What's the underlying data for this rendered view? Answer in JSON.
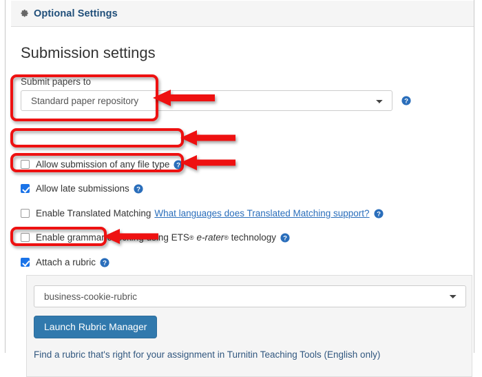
{
  "header": {
    "gear_icon": "gear-icon",
    "title": "Optional Settings"
  },
  "main": {
    "heading": "Submission settings",
    "submit_papers_to": {
      "label": "Submit papers to",
      "selected": "Standard paper repository",
      "help_icon": "question-mark-circle-icon"
    },
    "checkboxes": [
      {
        "name": "allow-any-file-type",
        "label": "Allow submission of any file type",
        "checked": false,
        "help_icon": "question-mark-circle-icon"
      },
      {
        "name": "allow-late-submissions",
        "label": "Allow late submissions",
        "checked": true,
        "help_icon": "question-mark-circle-icon"
      },
      {
        "name": "enable-translated-matching",
        "label": "Enable Translated Matching",
        "link": "What languages does Translated Matching support?",
        "checked": false,
        "help_icon": "question-mark-circle-icon"
      },
      {
        "name": "enable-grammar-check",
        "label_part1": "Enable grammar checking using ETS",
        "reg1": "®",
        "label_italic": "e-rater",
        "reg2": "®",
        "label_part2": "technology",
        "checked": false,
        "help_icon": "question-mark-circle-icon"
      },
      {
        "name": "attach-a-rubric",
        "label": "Attach a rubric",
        "checked": true,
        "help_icon": "question-mark-circle-icon"
      }
    ],
    "rubric_panel": {
      "selected_rubric": "business-cookie-rubric",
      "launch_button": "Launch Rubric Manager",
      "find_rubric_link": "Find a rubric that's right for your assignment in Turnitin Teaching Tools (English only)"
    }
  },
  "annotations": {
    "highlight_color": "#ee1111",
    "boxes": [
      "submit-papers-to-field",
      "allow-any-file-type-checkbox",
      "allow-late-submissions-checkbox",
      "attach-a-rubric-checkbox"
    ],
    "arrows": [
      "arrow-submit-papers-to",
      "arrow-allow-any-file-type",
      "arrow-allow-late-submissions",
      "arrow-attach-a-rubric"
    ]
  },
  "colors": {
    "header_title": "#1f4e79",
    "link": "#2a6ebb",
    "button_primary": "#3179ad",
    "checkbox_checked": "#1a73e8",
    "annotation_red": "#ee1111"
  }
}
